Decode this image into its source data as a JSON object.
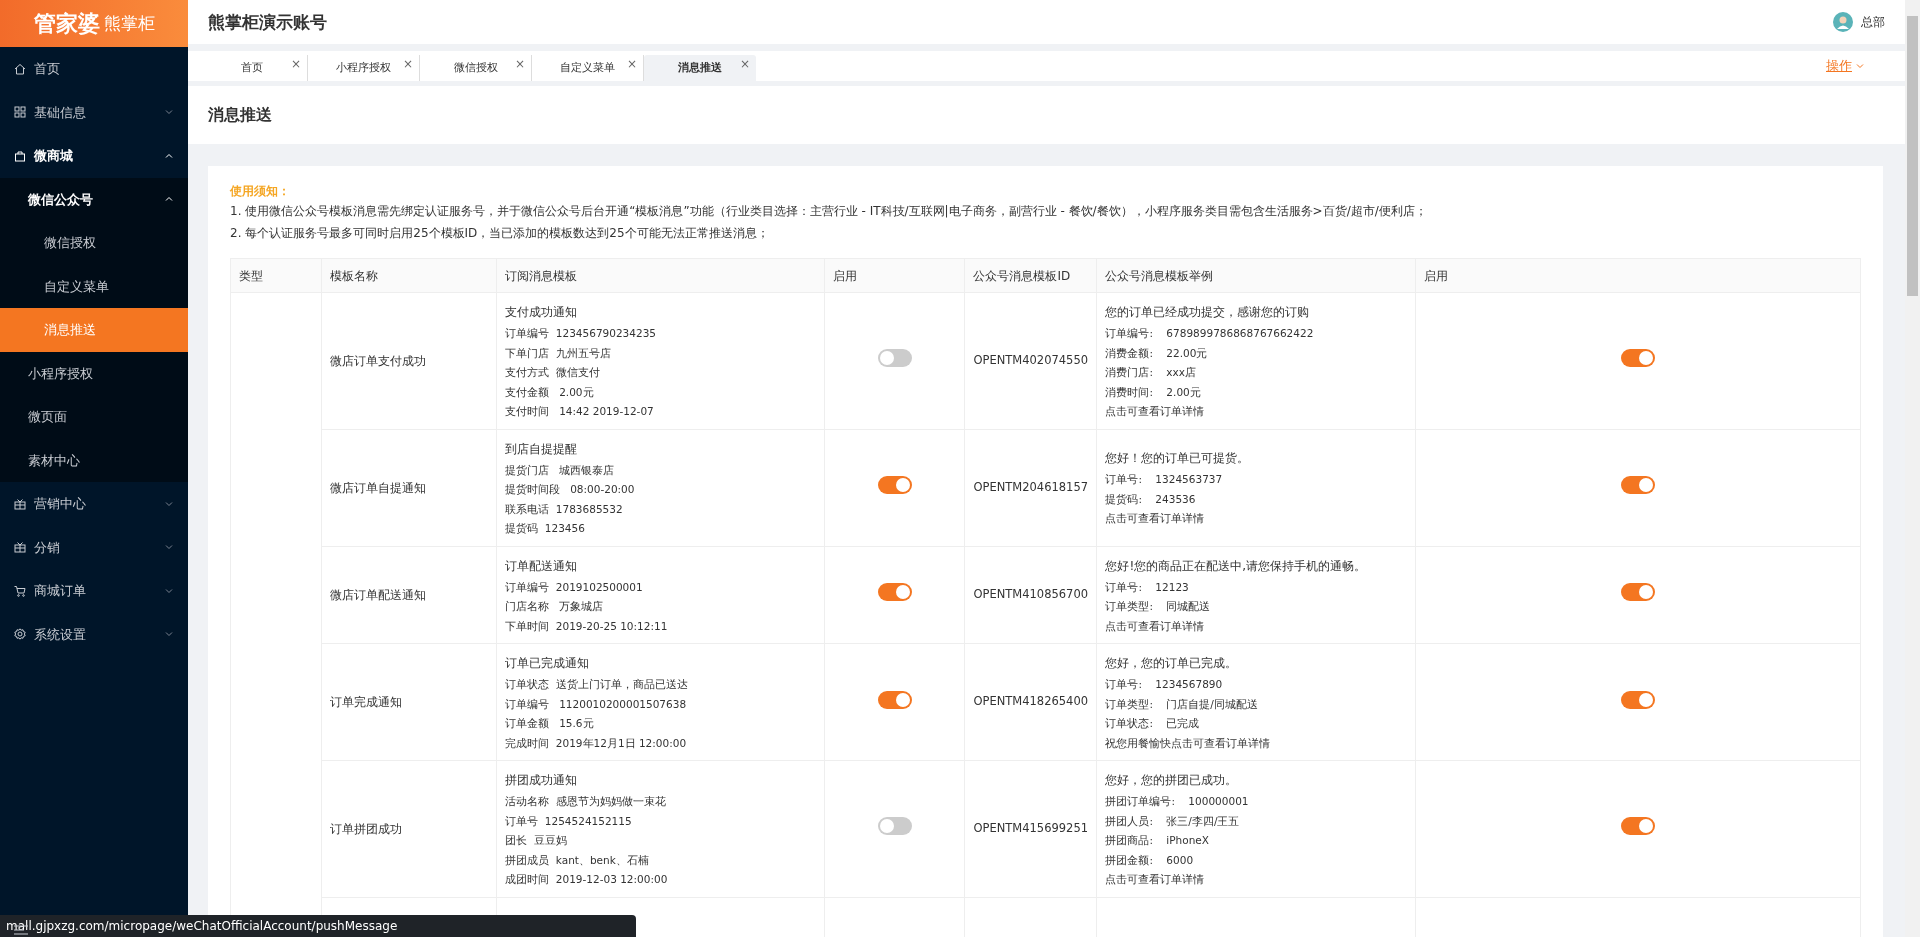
{
  "logo": {
    "brand": "管家婆",
    "product": "熊掌柜"
  },
  "sidebar": {
    "items": [
      {
        "label": "首页",
        "selected": false
      },
      {
        "label": "基础信息",
        "expanded": false,
        "selected": false
      },
      {
        "label": "微商城",
        "expanded": true,
        "selected": false,
        "children": [
          {
            "label": "微信公众号",
            "expanded": true,
            "selected": false,
            "children": [
              {
                "label": "微信授权",
                "selected": false
              },
              {
                "label": "自定义菜单",
                "selected": false
              },
              {
                "label": "消息推送",
                "selected": true
              }
            ]
          },
          {
            "label": "小程序授权",
            "selected": false
          },
          {
            "label": "微页面",
            "selected": false
          },
          {
            "label": "素材中心",
            "selected": false
          }
        ]
      },
      {
        "label": "营销中心",
        "expanded": false,
        "selected": false
      },
      {
        "label": "分销",
        "expanded": false,
        "selected": false
      },
      {
        "label": "商城订单",
        "expanded": false,
        "selected": false
      },
      {
        "label": "系统设置",
        "expanded": false,
        "selected": false
      }
    ]
  },
  "header": {
    "title": "熊掌柜演示账号",
    "user": "总部"
  },
  "tabs": [
    {
      "label": "首页",
      "selected": false
    },
    {
      "label": "小程序授权",
      "selected": false
    },
    {
      "label": "微信授权",
      "selected": false
    },
    {
      "label": "自定义菜单",
      "selected": false
    },
    {
      "label": "消息推送",
      "selected": true
    }
  ],
  "tab_close": "×",
  "operations": "操作",
  "page_title": "消息推送",
  "notice": {
    "title": "使用须知：",
    "lines": [
      "1. 使用微信公众号模板消息需先绑定认证服务号，并于微信公众号后台开通“模板消息”功能（行业类目选择：主营行业 - IT科技/互联网|电子商务，副营行业 - 餐饮/餐饮），小程序服务类目需包含生活服务>百货/超市/便利店；",
      "2. 每个认证服务号最多可同时启用25个模板ID，当已添加的模板数达到25个可能无法正常推送消息；"
    ]
  },
  "table": {
    "columns": [
      "类型",
      "模板名称",
      "订阅消息模板",
      "启用",
      "公众号消息模板ID",
      "公众号消息模板举例",
      "启用"
    ],
    "rows": [
      {
        "name": "微店订单支付成功",
        "template": {
          "title": "支付成功通知",
          "lines": [
            "订单编号  123456790234235",
            "下单门店  九州五号店",
            "支付方式  微信支付",
            "支付金额   2.00元",
            "支付时间   14:42 2019-12-07"
          ]
        },
        "enabled": false,
        "template_id": "OPENTM402074550",
        "example": {
          "title": "您的订单已经成功提交，感谢您的订购",
          "lines": [
            "订单编号:    6789899786868767662422",
            "消费金额:    22.00元",
            "消费门店:    xxx店",
            "消费时间:    2.00元",
            "点击可查看订单详情"
          ]
        },
        "example_enabled": true
      },
      {
        "name": "微店订单自提通知",
        "template": {
          "title": "到店自提提醒",
          "lines": [
            "提货门店   城西银泰店",
            "提货时间段   08:00-20:00",
            "联系电话  1783685532",
            "提货码  123456"
          ]
        },
        "enabled": true,
        "template_id": "OPENTM204618157",
        "example": {
          "title": "您好！您的订单已可提货。",
          "lines": [
            "订单号:    1324563737",
            "提货码:    243536",
            "点击可查看订单详情"
          ]
        },
        "example_enabled": true
      },
      {
        "name": "微店订单配送通知",
        "template": {
          "title": "订单配送通知",
          "lines": [
            "订单编号  2019102500001",
            "门店名称   万象城店",
            "下单时间  2019-20-25 10:12:11"
          ]
        },
        "enabled": true,
        "template_id": "OPENTM410856700",
        "example": {
          "title": "您好!您的商品正在配送中,请您保持手机的通畅。",
          "lines": [
            "订单号:    12123",
            "订单类型:    同城配送",
            "点击可查看订单详情"
          ]
        },
        "example_enabled": true
      },
      {
        "name": "订单完成通知",
        "template": {
          "title": "订单已完成通知",
          "lines": [
            "订单状态  送货上门订单，商品已送达",
            "订单编号   1120010200001507638",
            "订单金额   15.6元",
            "完成时间  2019年12月1日 12:00:00"
          ]
        },
        "enabled": true,
        "template_id": "OPENTM418265400",
        "example": {
          "title": "您好，您的订单已完成。",
          "lines": [
            "订单号:    1234567890",
            "订单类型:    门店自提/同城配送",
            "订单状态:    已完成",
            "祝您用餐愉快点击可查看订单详情"
          ]
        },
        "example_enabled": true
      },
      {
        "name": "订单拼团成功",
        "template": {
          "title": "拼团成功通知",
          "lines": [
            "活动名称  感恩节为妈妈做一束花",
            "订单号  1254524152115",
            "团长  豆豆妈",
            "拼团成员  kant、benk、石楠",
            "成团时间  2019-12-03 12:00:00"
          ]
        },
        "enabled": false,
        "template_id": "OPENTM415699251",
        "example": {
          "title": "您好，您的拼团已成功。",
          "lines": [
            "拼团订单编号:    100000001",
            "拼团人员:    张三/李四/王五",
            "拼团商品:    iPhoneX",
            "拼团金额:    6000",
            "点击可查看订单详情"
          ]
        },
        "example_enabled": true
      }
    ]
  },
  "status_bar": "mall.gjpxzg.com/micropage/weChatOfficialAccount/pushMessage"
}
